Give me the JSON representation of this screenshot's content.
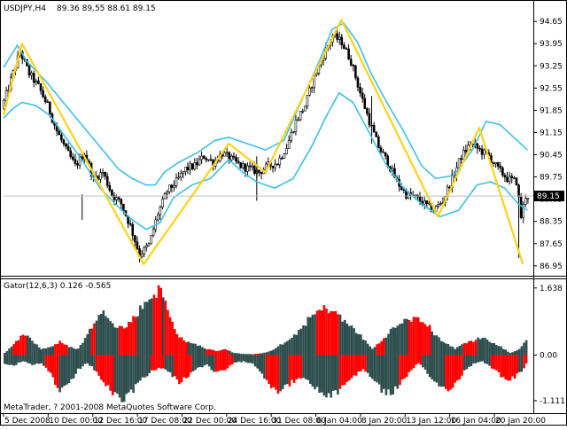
{
  "chart_data": [
    {
      "type": "candlestick",
      "title": "USDJPY,H4",
      "ohlc_readout": "89.36 89.55 88.61 89.15",
      "yticks": [
        "94.65",
        "93.95",
        "93.25",
        "92.55",
        "91.85",
        "91.15",
        "90.45",
        "89.75",
        "89.05",
        "88.35",
        "87.65",
        "86.95"
      ],
      "current_price_label": "89.15",
      "ylim": [
        86.75,
        94.85
      ],
      "xticks": [
        "5 Dec 2008",
        "10 Dec 00:00",
        "12 Dec 16:00",
        "17 Dec 08:00",
        "22 Dec 00:00",
        "24 Dec 16:00",
        "31 Dec 08:00",
        "6 Jan 04:00",
        "8 Jan 20:00",
        "13 Jan 12:00",
        "16 Jan 04:00",
        "20 Jan 20:00"
      ],
      "zigzag": {
        "color": "#ffd21a",
        "points": [
          [
            0,
            91.7
          ],
          [
            8,
            93.95
          ],
          [
            61,
            87.0
          ],
          [
            98,
            90.8
          ],
          [
            114,
            89.9
          ],
          [
            147,
            94.7
          ],
          [
            189,
            88.5
          ],
          [
            207,
            91.3
          ],
          [
            226,
            87.0
          ]
        ]
      },
      "envelope": {
        "color": "#3dc1e6",
        "upper": [
          [
            0,
            93.2
          ],
          [
            6,
            93.9
          ],
          [
            10,
            93.4
          ],
          [
            18,
            92.8
          ],
          [
            26,
            92.1
          ],
          [
            34,
            91.4
          ],
          [
            42,
            90.7
          ],
          [
            50,
            90.0
          ],
          [
            56,
            89.7
          ],
          [
            62,
            89.5
          ],
          [
            66,
            89.5
          ],
          [
            70,
            89.9
          ],
          [
            76,
            90.2
          ],
          [
            84,
            90.5
          ],
          [
            92,
            90.9
          ],
          [
            98,
            91.0
          ],
          [
            106,
            90.8
          ],
          [
            114,
            90.6
          ],
          [
            122,
            90.9
          ],
          [
            130,
            92.2
          ],
          [
            138,
            93.5
          ],
          [
            143,
            94.4
          ],
          [
            148,
            94.6
          ],
          [
            154,
            94.0
          ],
          [
            160,
            93.0
          ],
          [
            166,
            92.2
          ],
          [
            174,
            91.2
          ],
          [
            182,
            90.1
          ],
          [
            188,
            89.7
          ],
          [
            196,
            89.8
          ],
          [
            204,
            90.6
          ],
          [
            210,
            91.5
          ],
          [
            216,
            91.4
          ],
          [
            222,
            91.0
          ],
          [
            228,
            90.6
          ]
        ],
        "lower": [
          [
            0,
            91.6
          ],
          [
            4,
            91.9
          ],
          [
            8,
            92.1
          ],
          [
            14,
            92.0
          ],
          [
            20,
            91.7
          ],
          [
            26,
            91.1
          ],
          [
            34,
            90.3
          ],
          [
            42,
            89.4
          ],
          [
            50,
            88.8
          ],
          [
            56,
            88.4
          ],
          [
            62,
            88.1
          ],
          [
            68,
            88.3
          ],
          [
            74,
            89.1
          ],
          [
            82,
            89.5
          ],
          [
            90,
            89.7
          ],
          [
            98,
            90.3
          ],
          [
            104,
            89.9
          ],
          [
            110,
            89.6
          ],
          [
            118,
            89.4
          ],
          [
            126,
            89.7
          ],
          [
            134,
            90.7
          ],
          [
            140,
            91.6
          ],
          [
            146,
            92.4
          ],
          [
            152,
            92.1
          ],
          [
            158,
            91.3
          ],
          [
            166,
            90.2
          ],
          [
            174,
            89.4
          ],
          [
            182,
            88.9
          ],
          [
            190,
            88.5
          ],
          [
            198,
            88.7
          ],
          [
            206,
            89.5
          ],
          [
            212,
            89.6
          ],
          [
            218,
            89.4
          ],
          [
            224,
            88.9
          ],
          [
            228,
            88.7
          ]
        ]
      },
      "price_path": [
        [
          0,
          91.9
        ],
        [
          4,
          92.8
        ],
        [
          8,
          93.7
        ],
        [
          12,
          93.0
        ],
        [
          16,
          92.6
        ],
        [
          20,
          92.0
        ],
        [
          24,
          91.2
        ],
        [
          28,
          90.6
        ],
        [
          32,
          90.1
        ],
        [
          36,
          90.5
        ],
        [
          40,
          89.7
        ],
        [
          44,
          89.9
        ],
        [
          48,
          89.2
        ],
        [
          52,
          88.9
        ],
        [
          56,
          88.2
        ],
        [
          60,
          87.3
        ],
        [
          64,
          87.6
        ],
        [
          68,
          88.6
        ],
        [
          72,
          89.3
        ],
        [
          76,
          89.6
        ],
        [
          80,
          90.0
        ],
        [
          84,
          90.1
        ],
        [
          88,
          90.4
        ],
        [
          92,
          90.2
        ],
        [
          96,
          90.5
        ],
        [
          100,
          90.3
        ],
        [
          104,
          90.1
        ],
        [
          108,
          90.0
        ],
        [
          112,
          89.9
        ],
        [
          116,
          90.1
        ],
        [
          120,
          90.2
        ],
        [
          124,
          90.7
        ],
        [
          128,
          91.5
        ],
        [
          132,
          92.0
        ],
        [
          136,
          92.9
        ],
        [
          140,
          93.6
        ],
        [
          144,
          94.2
        ],
        [
          148,
          94.0
        ],
        [
          152,
          93.4
        ],
        [
          156,
          92.4
        ],
        [
          160,
          91.5
        ],
        [
          164,
          90.7
        ],
        [
          168,
          90.2
        ],
        [
          172,
          89.6
        ],
        [
          176,
          89.2
        ],
        [
          180,
          89.1
        ],
        [
          184,
          88.9
        ],
        [
          188,
          88.7
        ],
        [
          192,
          89.0
        ],
        [
          196,
          89.7
        ],
        [
          200,
          90.4
        ],
        [
          204,
          90.8
        ],
        [
          208,
          90.6
        ],
        [
          212,
          90.4
        ],
        [
          216,
          90.0
        ],
        [
          220,
          89.7
        ],
        [
          224,
          89.6
        ],
        [
          226,
          88.5
        ],
        [
          228,
          89.15
        ]
      ],
      "x_count": 230
    },
    {
      "type": "bar",
      "title": "Gator(12,6,3) 0.126 -0.565",
      "yticks": [
        "1.638",
        "0.00",
        "-1.111"
      ],
      "ylim": [
        -1.2,
        1.72
      ],
      "colors": {
        "up": "#ff0000",
        "down": "#2f4f4f"
      },
      "upper_profile": [
        [
          0,
          0.05
        ],
        [
          4,
          0.25
        ],
        [
          8,
          0.55
        ],
        [
          12,
          0.35
        ],
        [
          16,
          0.15
        ],
        [
          20,
          0.2
        ],
        [
          24,
          0.32
        ],
        [
          28,
          0.2
        ],
        [
          32,
          0.15
        ],
        [
          36,
          0.5
        ],
        [
          40,
          0.9
        ],
        [
          44,
          1.05
        ],
        [
          48,
          0.75
        ],
        [
          52,
          0.65
        ],
        [
          56,
          0.9
        ],
        [
          60,
          1.2
        ],
        [
          64,
          1.45
        ],
        [
          68,
          1.62
        ],
        [
          72,
          0.9
        ],
        [
          76,
          0.45
        ],
        [
          80,
          0.3
        ],
        [
          84,
          0.25
        ],
        [
          88,
          0.15
        ],
        [
          92,
          0.1
        ],
        [
          96,
          0.15
        ],
        [
          100,
          0.05
        ],
        [
          104,
          0.03
        ],
        [
          108,
          0.02
        ],
        [
          112,
          0.05
        ],
        [
          116,
          0.1
        ],
        [
          120,
          0.25
        ],
        [
          124,
          0.35
        ],
        [
          128,
          0.6
        ],
        [
          132,
          0.85
        ],
        [
          136,
          1.05
        ],
        [
          140,
          1.15
        ],
        [
          144,
          1.05
        ],
        [
          148,
          0.8
        ],
        [
          152,
          0.65
        ],
        [
          156,
          0.4
        ],
        [
          160,
          0.15
        ],
        [
          164,
          0.35
        ],
        [
          168,
          0.6
        ],
        [
          172,
          0.75
        ],
        [
          176,
          0.9
        ],
        [
          180,
          0.85
        ],
        [
          184,
          0.75
        ],
        [
          188,
          0.45
        ],
        [
          192,
          0.3
        ],
        [
          196,
          0.15
        ],
        [
          200,
          0.3
        ],
        [
          204,
          0.35
        ],
        [
          208,
          0.45
        ],
        [
          212,
          0.3
        ],
        [
          216,
          0.2
        ],
        [
          220,
          0.05
        ],
        [
          224,
          0.15
        ],
        [
          228,
          0.45
        ]
      ],
      "lower_profile": [
        [
          0,
          0.2
        ],
        [
          4,
          0.25
        ],
        [
          8,
          0.15
        ],
        [
          12,
          0.25
        ],
        [
          16,
          0.2
        ],
        [
          20,
          0.45
        ],
        [
          24,
          0.9
        ],
        [
          28,
          0.75
        ],
        [
          32,
          0.35
        ],
        [
          36,
          0.2
        ],
        [
          40,
          0.4
        ],
        [
          44,
          0.75
        ],
        [
          48,
          1.0
        ],
        [
          52,
          1.1
        ],
        [
          56,
          0.85
        ],
        [
          60,
          0.55
        ],
        [
          64,
          0.4
        ],
        [
          68,
          0.3
        ],
        [
          72,
          0.45
        ],
        [
          76,
          0.65
        ],
        [
          80,
          0.5
        ],
        [
          84,
          0.3
        ],
        [
          88,
          0.25
        ],
        [
          92,
          0.45
        ],
        [
          96,
          0.35
        ],
        [
          100,
          0.2
        ],
        [
          104,
          0.15
        ],
        [
          108,
          0.2
        ],
        [
          112,
          0.45
        ],
        [
          116,
          0.75
        ],
        [
          120,
          0.9
        ],
        [
          124,
          0.7
        ],
        [
          128,
          0.55
        ],
        [
          132,
          0.65
        ],
        [
          136,
          0.85
        ],
        [
          140,
          1.0
        ],
        [
          144,
          0.95
        ],
        [
          148,
          0.7
        ],
        [
          152,
          0.5
        ],
        [
          156,
          0.35
        ],
        [
          160,
          0.55
        ],
        [
          164,
          0.85
        ],
        [
          168,
          0.95
        ],
        [
          172,
          0.7
        ],
        [
          176,
          0.45
        ],
        [
          180,
          0.2
        ],
        [
          184,
          0.45
        ],
        [
          188,
          0.7
        ],
        [
          192,
          0.85
        ],
        [
          196,
          0.7
        ],
        [
          200,
          0.4
        ],
        [
          204,
          0.2
        ],
        [
          208,
          0.15
        ],
        [
          212,
          0.3
        ],
        [
          216,
          0.5
        ],
        [
          220,
          0.6
        ],
        [
          224,
          0.45
        ],
        [
          228,
          0.15
        ]
      ],
      "upper_red_ranges": [
        [
          4,
          10
        ],
        [
          22,
          28
        ],
        [
          38,
          40
        ],
        [
          50,
          58
        ],
        [
          65,
          69
        ],
        [
          70,
          80
        ],
        [
          88,
          98
        ],
        [
          108,
          112
        ],
        [
          136,
          146
        ],
        [
          162,
          166
        ],
        [
          176,
          186
        ],
        [
          200,
          206
        ]
      ],
      "lower_red_ranges": [
        [
          18,
          24
        ],
        [
          40,
          48
        ],
        [
          64,
          70
        ],
        [
          74,
          82
        ],
        [
          92,
          100
        ],
        [
          114,
          120
        ],
        [
          124,
          130
        ],
        [
          146,
          158
        ],
        [
          172,
          182
        ],
        [
          192,
          200
        ],
        [
          212,
          224
        ],
        [
          226,
          229
        ]
      ]
    }
  ],
  "copyright": "MetaTrader, ? 2001-2008 MetaQuotes Software Corp."
}
